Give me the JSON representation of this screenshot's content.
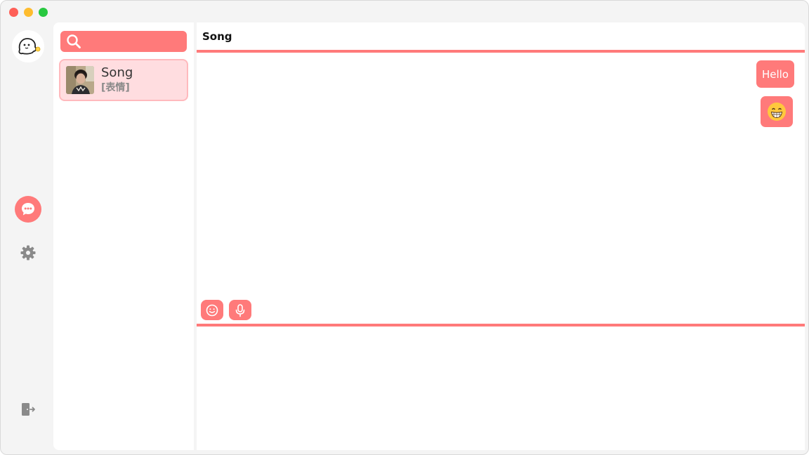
{
  "window": {
    "controls": [
      "close",
      "minimize",
      "zoom"
    ]
  },
  "rail": {
    "avatar_icon": "ghost-mascot-icon",
    "items": [
      {
        "icon": "chat-bubble-icon",
        "active": true
      },
      {
        "icon": "gear-icon",
        "active": false
      }
    ],
    "logout_icon": "logout-door-icon"
  },
  "search": {
    "icon": "search-icon",
    "placeholder": "",
    "value": ""
  },
  "contacts": [
    {
      "name": "Song",
      "preview": "[表情]",
      "selected": true
    }
  ],
  "chat": {
    "title": "Song",
    "messages": [
      {
        "type": "text",
        "text": "Hello",
        "from": "me"
      },
      {
        "type": "emoji",
        "emoji": "😁",
        "from": "me"
      }
    ],
    "toolbar": {
      "emoji_icon": "smiley-icon",
      "voice_icon": "microphone-icon"
    },
    "composer_value": ""
  },
  "colors": {
    "accent": "#ff7a7a",
    "selected_bg": "#ffdde0",
    "selected_border": "#ffb9bd",
    "window_bg": "#f4f4f4"
  }
}
